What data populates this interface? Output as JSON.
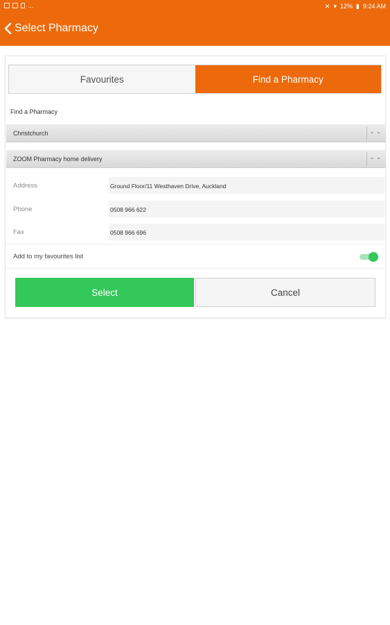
{
  "status_bar": {
    "battery": "12%",
    "time": "9:24 AM"
  },
  "app_bar": {
    "title": "Select Pharmacy"
  },
  "tabs": [
    {
      "label": "Favourites",
      "selected": false
    },
    {
      "label": "Find a Pharmacy",
      "selected": true
    }
  ],
  "section": {
    "title": "Find a Pharmacy"
  },
  "city_dropdown": {
    "value": "Christchurch"
  },
  "pharmacy_dropdown": {
    "value": "ZOOM Pharmacy home delivery"
  },
  "details": {
    "address": {
      "label": "Address",
      "value": "Ground Floor/11 Westhaven Drive, Auckland"
    },
    "phone": {
      "label": "Phone",
      "value": "0508 966 622"
    },
    "fax": {
      "label": "Fax",
      "value": "0508 966 696"
    }
  },
  "favourites_toggle": {
    "label": "Add to my favourites list",
    "on": true
  },
  "buttons": {
    "select": "Select",
    "cancel": "Cancel"
  },
  "colors": {
    "brand_orange": "#ec6a0c",
    "select_green": "#34c759"
  }
}
